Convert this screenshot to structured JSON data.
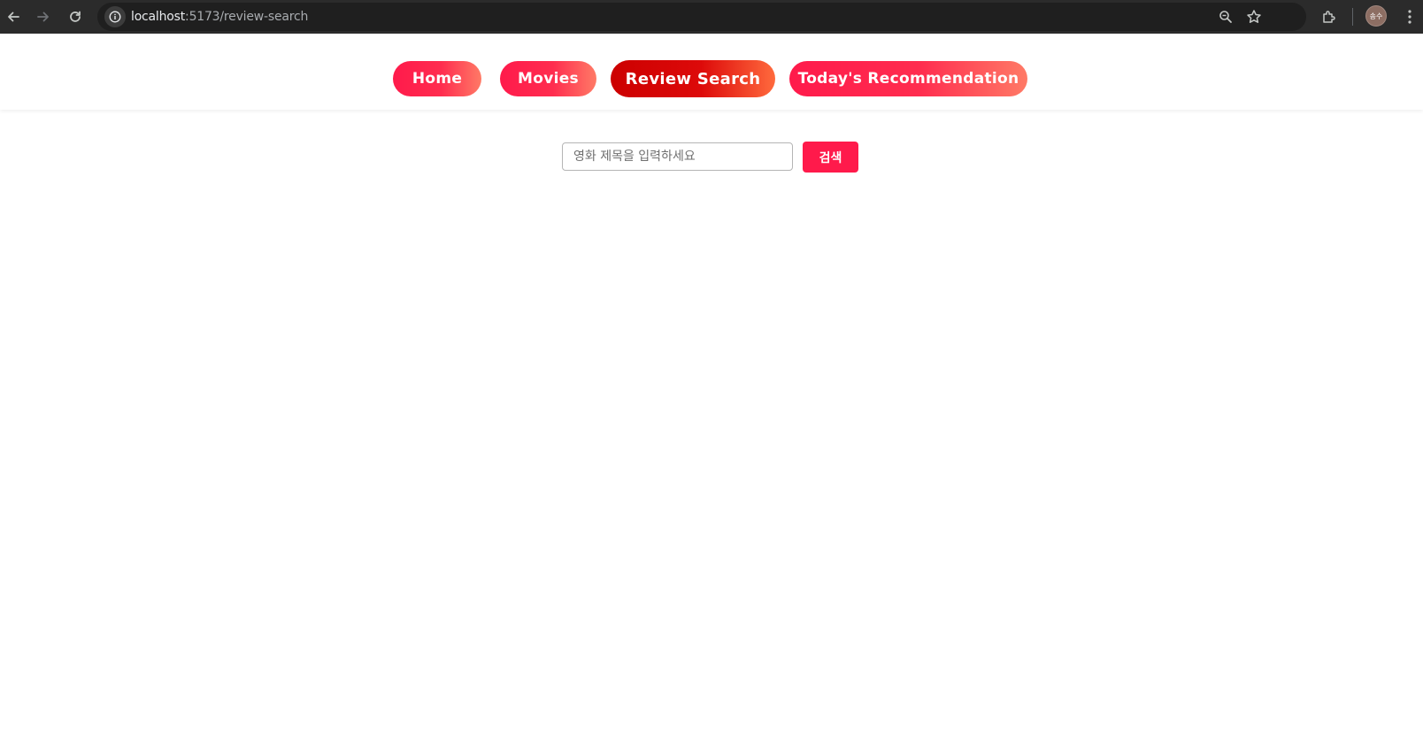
{
  "browser": {
    "url_host": "localhost",
    "url_rest": ":5173/review-search",
    "avatar_text": "송수",
    "icons": [
      "back-arrow-icon",
      "forward-arrow-icon",
      "reload-icon",
      "site-info-icon",
      "zoom-icon",
      "bookmark-star-icon",
      "extensions-icon",
      "profile-avatar",
      "kebab-menu-icon"
    ]
  },
  "nav": {
    "items": [
      {
        "label": "Home",
        "active": false
      },
      {
        "label": "Movies",
        "active": false
      },
      {
        "label": "Review Search",
        "active": true
      },
      {
        "label": "Today's Recommendation",
        "active": false
      }
    ]
  },
  "search": {
    "placeholder": "영화 제목을 입력하세요",
    "value": "",
    "button_label": "검색"
  },
  "colors": {
    "accent": "#ff1a4b",
    "active_start": "#cc0000",
    "gradient_end": "#ff7a66",
    "chrome_bg": "#2b2b2b"
  }
}
